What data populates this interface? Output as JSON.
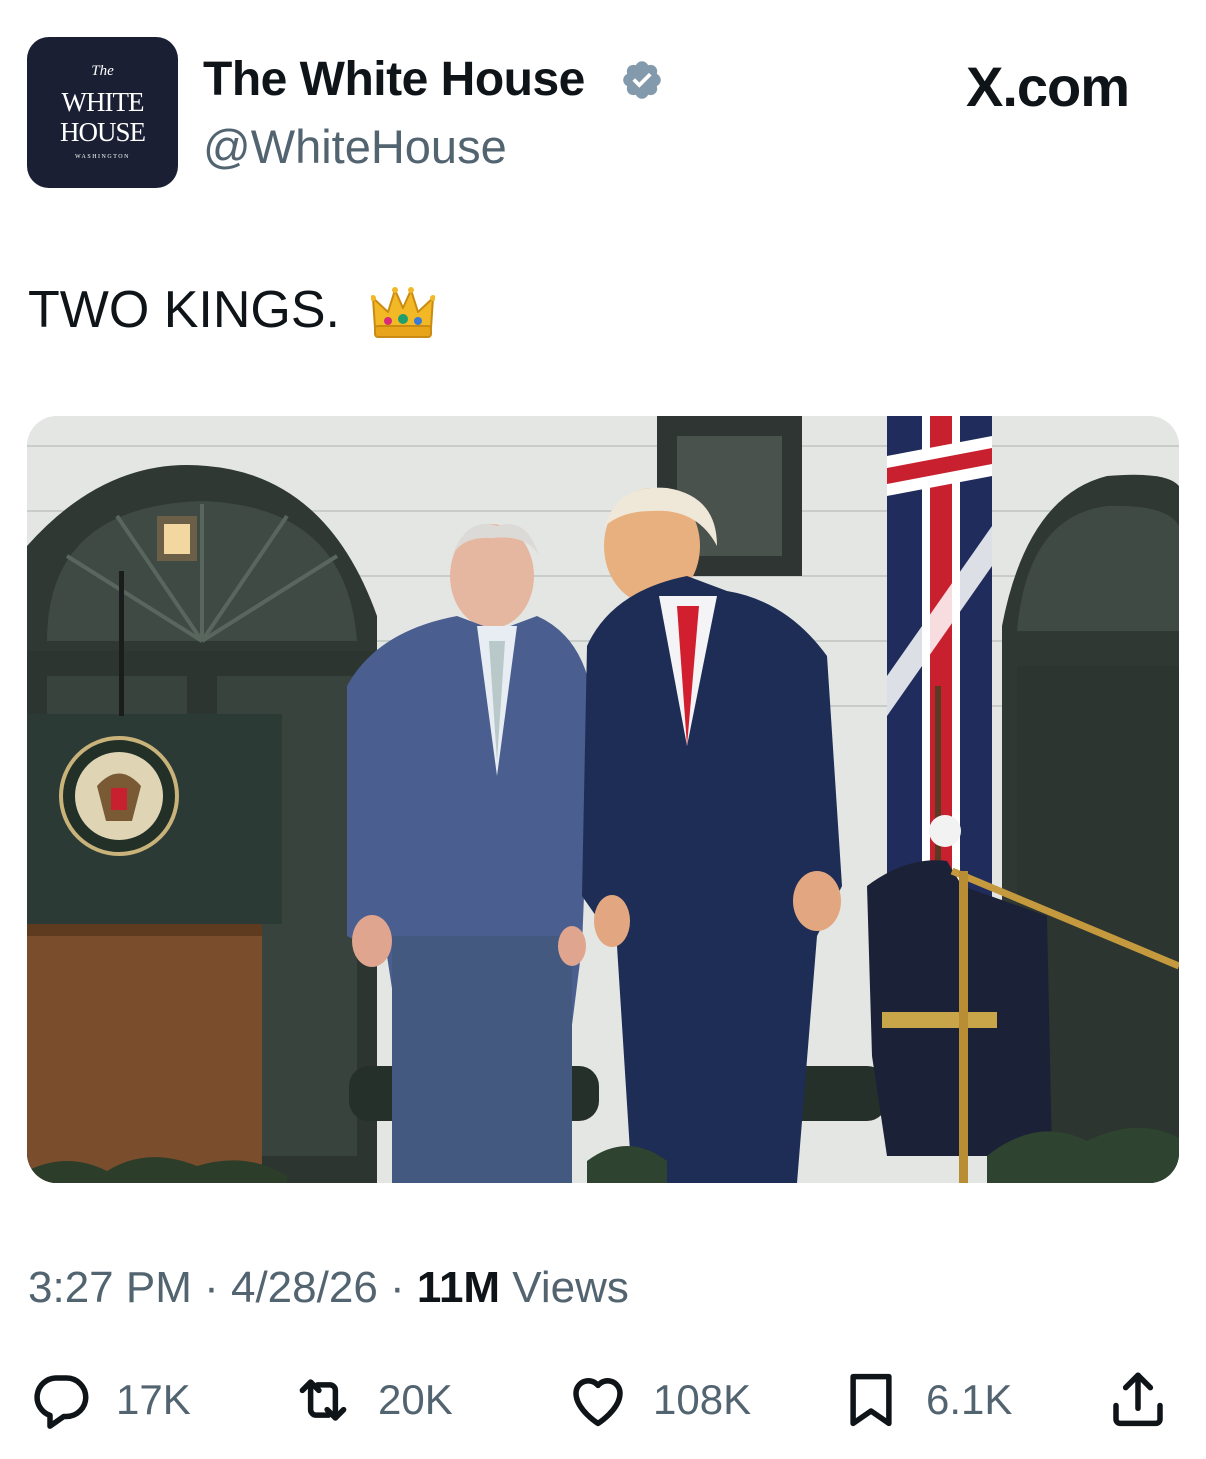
{
  "author": {
    "avatar_top": "The",
    "avatar_line1": "WHITE",
    "avatar_line2": "HOUSE",
    "avatar_bottom": "WASHINGTON",
    "name": "The White House",
    "handle": "@WhiteHouse",
    "verified_icon": "verified-badge-icon"
  },
  "brand": "X.com",
  "tweet": {
    "text": "TWO KINGS.",
    "emoji_icon": "crown-icon"
  },
  "meta": {
    "time": "3:27 PM",
    "sep1": " · ",
    "date": "4/28/26",
    "sep2": " · ",
    "views_count": "11M",
    "views_label": " Views"
  },
  "actions": {
    "replies": "17K",
    "reposts": "20K",
    "likes": "108K",
    "bookmarks": "6.1K"
  },
  "colors": {
    "text": "#0f1419",
    "secondary": "#536471",
    "avatar_bg": "#1a1f33",
    "verified": "#829aab"
  }
}
